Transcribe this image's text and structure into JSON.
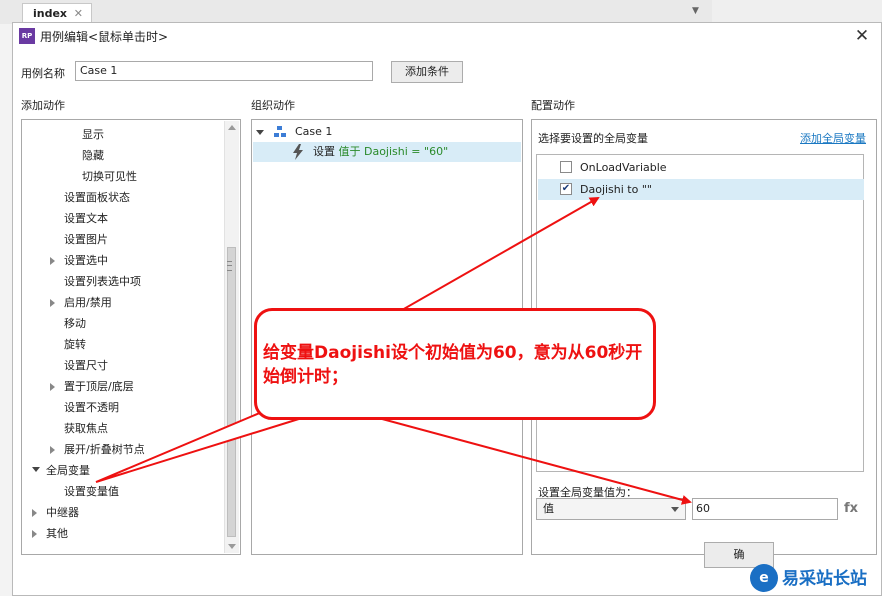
{
  "background": {
    "tab_label": "index",
    "tab_close": "✕",
    "collapse_glyph": "▼"
  },
  "dialog": {
    "title": "用例编辑<鼠标单击时>",
    "app_icon_text": "RP",
    "close_glyph": "✕",
    "case_name_label": "用例名称",
    "case_name_value": "Case 1",
    "add_condition_button": "添加条件",
    "ok_button_partial": "确"
  },
  "add_actions": {
    "header": "添加动作",
    "items": [
      {
        "label": "显示",
        "expander": "none"
      },
      {
        "label": "隐藏",
        "expander": "none"
      },
      {
        "label": "切换可见性",
        "expander": "none"
      },
      {
        "label": "设置面板状态",
        "expander": "none"
      },
      {
        "label": "设置文本",
        "expander": "none"
      },
      {
        "label": "设置图片",
        "expander": "none"
      },
      {
        "label": "设置选中",
        "expander": "collapsed"
      },
      {
        "label": "设置列表选中项",
        "expander": "none"
      },
      {
        "label": "启用/禁用",
        "expander": "collapsed"
      },
      {
        "label": "移动",
        "expander": "none"
      },
      {
        "label": "旋转",
        "expander": "none"
      },
      {
        "label": "设置尺寸",
        "expander": "none"
      },
      {
        "label": "置于顶层/底层",
        "expander": "collapsed"
      },
      {
        "label": "设置不透明",
        "expander": "none"
      },
      {
        "label": "获取焦点",
        "expander": "none"
      },
      {
        "label": "展开/折叠树节点",
        "expander": "collapsed"
      },
      {
        "label": "全局变量",
        "expander": "expanded"
      },
      {
        "label": "设置变量值",
        "expander": "none"
      },
      {
        "label": "中继器",
        "expander": "collapsed"
      },
      {
        "label": "其他",
        "expander": "collapsed"
      }
    ]
  },
  "organize_actions": {
    "header": "组织动作",
    "case_label": "Case 1",
    "action_prefix": "设置",
    "action_detail": "值于 Daojishi = \"60\""
  },
  "config_actions": {
    "header": "配置动作",
    "select_label": "选择要设置的全局变量",
    "add_global_link": "添加全局变量",
    "variables": [
      {
        "name": "OnLoadVariable",
        "checked": false
      },
      {
        "name": "Daojishi to \"\"",
        "checked": true
      }
    ],
    "set_value_label": "设置全局变量值为：",
    "value_type": "值",
    "value": "60",
    "fx_label": "fx"
  },
  "annotation": {
    "text": "给变量Daojishi设个初始值为60，意为从60秒开始倒计时；",
    "color": "#ee1111"
  },
  "watermark": {
    "logo_glyph": "e",
    "site_name": "易采站长站"
  }
}
